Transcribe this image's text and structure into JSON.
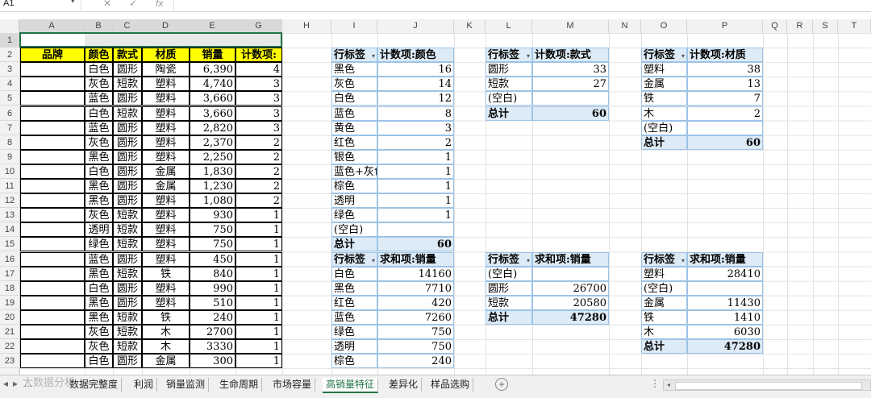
{
  "formula_bar": {
    "cell_ref": "A1",
    "icons": [
      "cancel-icon",
      "confirm-icon",
      "function-icon"
    ],
    "fx_label": "fx"
  },
  "columns": [
    "A",
    "B",
    "C",
    "D",
    "E",
    "G",
    "H",
    "I",
    "J",
    "K",
    "L",
    "M",
    "N",
    "O",
    "P",
    "Q",
    "R",
    "S",
    "T"
  ],
  "rows": [
    "1",
    "2",
    "3",
    "4",
    "5",
    "6",
    "7",
    "8",
    "9",
    "10",
    "11",
    "12",
    "13",
    "14",
    "15",
    "16",
    "17",
    "18",
    "19",
    "20",
    "21",
    "22",
    "23"
  ],
  "source_table": {
    "headers": [
      "品牌",
      "颜色",
      "款式",
      "材质",
      "销量",
      "计数项:"
    ],
    "rows": [
      [
        "",
        "白色",
        "圆形",
        "陶瓷",
        "6,390",
        "4"
      ],
      [
        "",
        "灰色",
        "短款",
        "塑料",
        "4,740",
        "3"
      ],
      [
        "",
        "蓝色",
        "圆形",
        "塑料",
        "3,660",
        "3"
      ],
      [
        "",
        "白色",
        "短款",
        "塑料",
        "3,660",
        "3"
      ],
      [
        "",
        "蓝色",
        "圆形",
        "塑料",
        "2,820",
        "3"
      ],
      [
        "",
        "灰色",
        "圆形",
        "塑料",
        "2,370",
        "2"
      ],
      [
        "",
        "黑色",
        "圆形",
        "塑料",
        "2,250",
        "2"
      ],
      [
        "",
        "白色",
        "圆形",
        "金属",
        "1,830",
        "2"
      ],
      [
        "",
        "黑色",
        "圆形",
        "金属",
        "1,230",
        "2"
      ],
      [
        "",
        "黑色",
        "圆形",
        "塑料",
        "1,080",
        "2"
      ],
      [
        "",
        "灰色",
        "短款",
        "塑料",
        "930",
        "1"
      ],
      [
        "",
        "透明",
        "短款",
        "塑料",
        "750",
        "1"
      ],
      [
        "",
        "绿色",
        "短款",
        "塑料",
        "750",
        "1"
      ],
      [
        "",
        "蓝色",
        "圆形",
        "塑料",
        "450",
        "1"
      ],
      [
        "",
        "黑色",
        "短款",
        "铁",
        "840",
        "1"
      ],
      [
        "",
        "白色",
        "圆形",
        "塑料",
        "990",
        "1"
      ],
      [
        "",
        "黑色",
        "圆形",
        "塑料",
        "510",
        "1"
      ],
      [
        "",
        "黑色",
        "短款",
        "铁",
        "240",
        "1"
      ],
      [
        "",
        "灰色",
        "短款",
        "木",
        "2700",
        "1"
      ],
      [
        "",
        "灰色",
        "短款",
        "木",
        "3330",
        "1"
      ],
      [
        "",
        "白色",
        "圆形",
        "金属",
        "300",
        "1"
      ]
    ]
  },
  "pivot_color_count": {
    "headers": [
      "行标签",
      "计数项:颜色"
    ],
    "rows": [
      [
        "黑色",
        "16"
      ],
      [
        "灰色",
        "14"
      ],
      [
        "白色",
        "12"
      ],
      [
        "蓝色",
        "8"
      ],
      [
        "黄色",
        "3"
      ],
      [
        "红色",
        "2"
      ],
      [
        "银色",
        "1"
      ],
      [
        "蓝色+灰色",
        "1"
      ],
      [
        "棕色",
        "1"
      ],
      [
        "透明",
        "1"
      ],
      [
        "绿色",
        "1"
      ],
      [
        "(空白)",
        ""
      ]
    ],
    "total": [
      "总计",
      "60"
    ]
  },
  "pivot_color_sum": {
    "headers": [
      "行标签",
      "求和项:销量"
    ],
    "rows": [
      [
        "白色",
        "14160"
      ],
      [
        "黑色",
        "7710"
      ],
      [
        "红色",
        "420"
      ],
      [
        "蓝色",
        "7260"
      ],
      [
        "绿色",
        "750"
      ],
      [
        "透明",
        "750"
      ],
      [
        "棕色",
        "240"
      ]
    ]
  },
  "pivot_style_count": {
    "headers": [
      "行标签",
      "计数项:款式"
    ],
    "rows": [
      [
        "圆形",
        "33"
      ],
      [
        "短款",
        "27"
      ],
      [
        "(空白)",
        ""
      ]
    ],
    "total": [
      "总计",
      "60"
    ]
  },
  "pivot_style_sum": {
    "headers": [
      "行标签",
      "求和项:销量"
    ],
    "rows": [
      [
        "(空白)",
        ""
      ],
      [
        "圆形",
        "26700"
      ],
      [
        "短款",
        "20580"
      ]
    ],
    "total": [
      "总计",
      "47280"
    ]
  },
  "pivot_material_count": {
    "headers": [
      "行标签",
      "计数项:材质"
    ],
    "rows": [
      [
        "塑料",
        "38"
      ],
      [
        "金属",
        "13"
      ],
      [
        "铁",
        "7"
      ],
      [
        "木",
        "2"
      ],
      [
        "(空白)",
        ""
      ]
    ],
    "total": [
      "总计",
      "60"
    ]
  },
  "pivot_material_sum": {
    "headers": [
      "行标签",
      "求和项:销量"
    ],
    "rows": [
      [
        "塑料",
        "28410"
      ],
      [
        "(空白)",
        ""
      ],
      [
        "金属",
        "11430"
      ],
      [
        "铁",
        "1410"
      ],
      [
        "木",
        "6030"
      ]
    ],
    "total": [
      "总计",
      "47280"
    ]
  },
  "sheet_tabs": [
    "数据完整度",
    "利润",
    "销量监测",
    "生命周期",
    "市场容量",
    "高销量特征",
    "差异化",
    "样品选购"
  ],
  "active_tab": "高销量特征",
  "tab_controls": {
    "add": "+",
    "more": "...",
    "scroll_left": "◂",
    "scroll_right": "▸"
  },
  "watermark": "大数据分析"
}
